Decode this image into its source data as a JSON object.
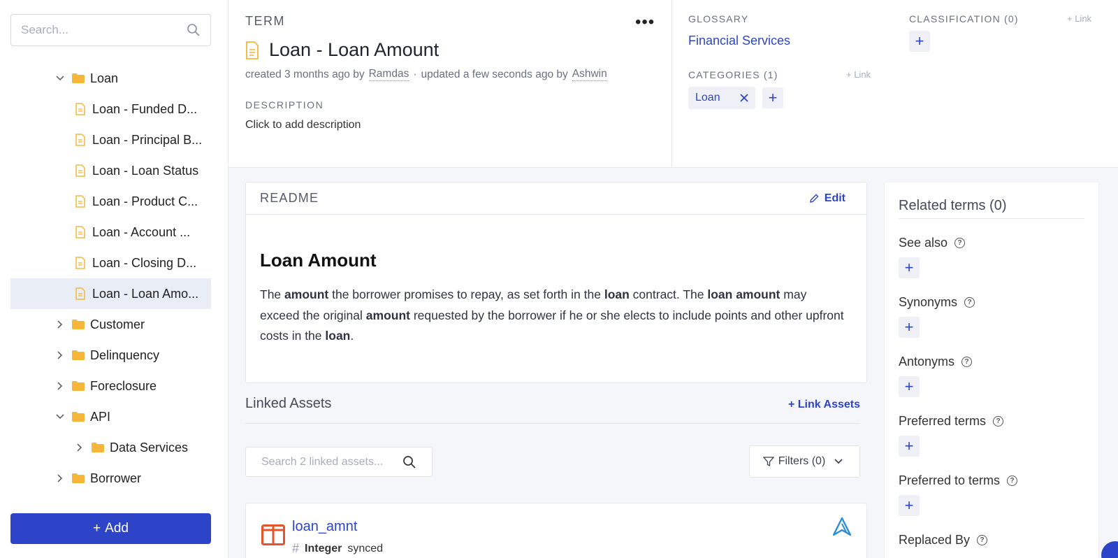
{
  "sidebar": {
    "search_placeholder": "Search...",
    "tree": [
      {
        "label": "Loan",
        "kind": "folder",
        "expanded": true,
        "depth": 0
      },
      {
        "label": "Loan - Funded D...",
        "kind": "term",
        "depth": 1
      },
      {
        "label": "Loan - Principal B...",
        "kind": "term",
        "depth": 1
      },
      {
        "label": "Loan - Loan Status",
        "kind": "term",
        "depth": 1
      },
      {
        "label": "Loan - Product C...",
        "kind": "term",
        "depth": 1
      },
      {
        "label": "Loan - Account ...",
        "kind": "term",
        "depth": 1
      },
      {
        "label": "Loan - Closing D...",
        "kind": "term",
        "depth": 1
      },
      {
        "label": "Loan - Loan Amo...",
        "kind": "term",
        "depth": 1,
        "selected": true
      },
      {
        "label": "Customer",
        "kind": "folder",
        "expanded": false,
        "depth": 0
      },
      {
        "label": "Delinquency",
        "kind": "folder",
        "expanded": false,
        "depth": 0
      },
      {
        "label": "Foreclosure",
        "kind": "folder",
        "expanded": false,
        "depth": 0
      },
      {
        "label": "API",
        "kind": "folder",
        "expanded": true,
        "depth": 0
      },
      {
        "label": "Data Services",
        "kind": "folder",
        "expanded": false,
        "depth": 1
      },
      {
        "label": "Borrower",
        "kind": "folder",
        "expanded": false,
        "depth": 0
      }
    ],
    "add_label": "Add"
  },
  "header": {
    "kind_label": "TERM",
    "more_label": "•••",
    "title": "Loan - Loan Amount",
    "created_prefix": "created 3 months ago by",
    "created_by": "Ramdas",
    "separator": "·",
    "updated_prefix": "updated a few seconds ago by",
    "updated_by": "Ashwin",
    "description_label": "DESCRIPTION",
    "description_value": "Click to add description",
    "glossary_label": "GLOSSARY",
    "glossary_value": "Financial Services",
    "classification_label": "CLASSIFICATION (0)",
    "classification_link": "+ Link",
    "categories_label": "CATEGORIES (1)",
    "categories_link": "+ Link",
    "category_chip": "Loan"
  },
  "readme": {
    "label": "README",
    "edit_label": "Edit",
    "title": "Loan Amount",
    "body": [
      {
        "t": "The ",
        "b": false
      },
      {
        "t": "amount",
        "b": true
      },
      {
        "t": " the borrower promises to repay, as set forth in the ",
        "b": false
      },
      {
        "t": "loan",
        "b": true
      },
      {
        "t": " contract. The ",
        "b": false
      },
      {
        "t": "loan amount",
        "b": true
      },
      {
        "t": " may exceed the original ",
        "b": false
      },
      {
        "t": "amount",
        "b": true
      },
      {
        "t": " requested by the borrower if he or she elects to include points and other upfront costs in the ",
        "b": false
      },
      {
        "t": "loan",
        "b": true
      },
      {
        "t": ".",
        "b": false
      }
    ]
  },
  "linked_assets": {
    "title": "Linked Assets",
    "link_label": "+ Link Assets",
    "search_placeholder": "Search 2 linked assets...",
    "filters_label": "Filters (0)",
    "assets": [
      {
        "name": "loan_amnt",
        "type_symbol": "#",
        "type": "Integer",
        "status": "synced"
      }
    ]
  },
  "related": {
    "title": "Related terms (0)",
    "groups": [
      "See also",
      "Synonyms",
      "Antonyms",
      "Preferred terms",
      "Preferred to terms",
      "Replaced By"
    ]
  },
  "colors": {
    "accent": "#2e44c8",
    "folder": "#f5b63a",
    "term_icon": "#f5b63a",
    "selected_bg": "#e8edf6",
    "column_icon": "#e2562e"
  }
}
